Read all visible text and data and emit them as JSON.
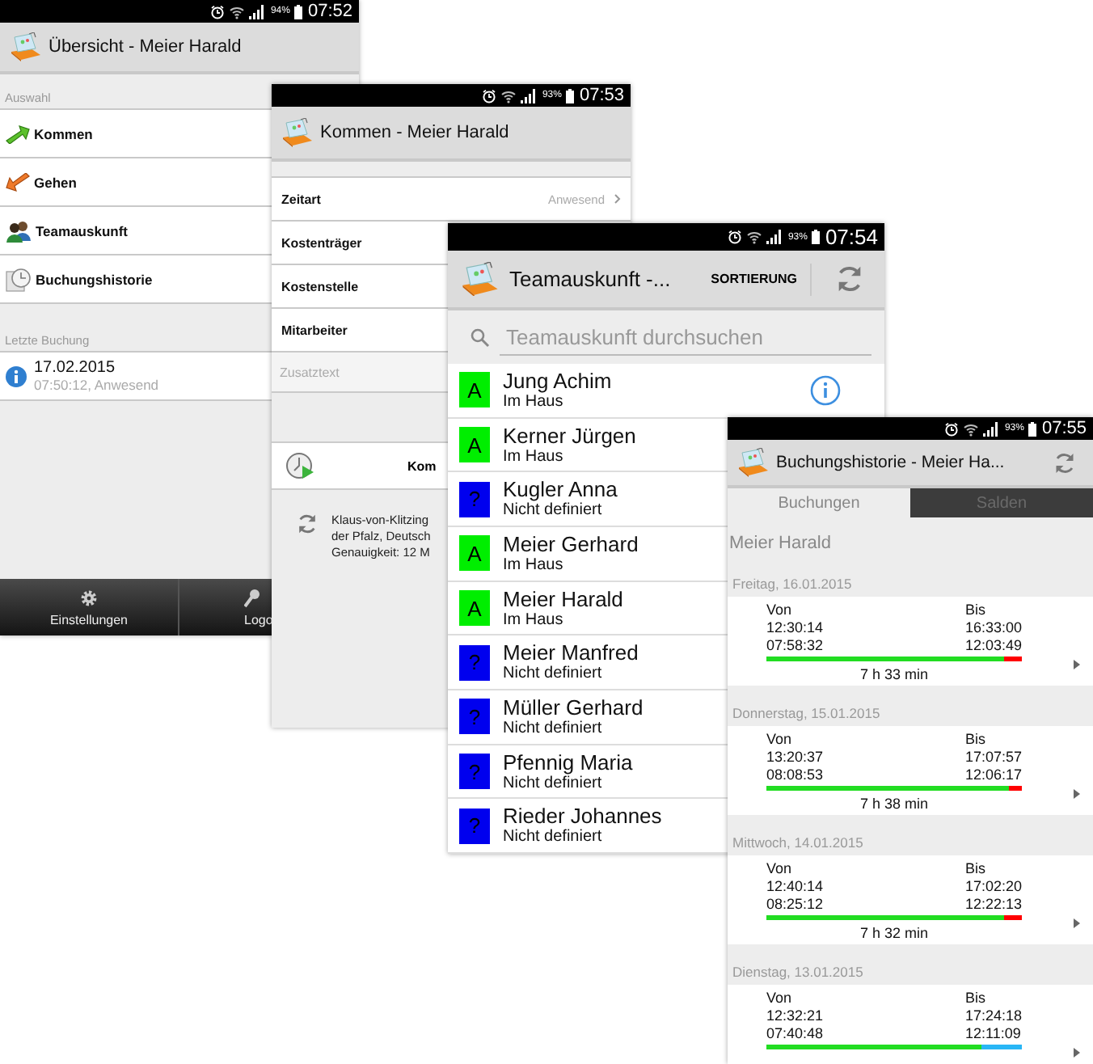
{
  "overview": {
    "status_bar": {
      "battery": "94%",
      "time": "07:52"
    },
    "title": "Übersicht - Meier Harald",
    "section": "Auswahl",
    "menu": [
      {
        "label": "Kommen",
        "kind": "arrive"
      },
      {
        "label": "Gehen",
        "kind": "leave"
      },
      {
        "label": "Teamauskunft",
        "kind": "team"
      },
      {
        "label": "Buchungshistorie",
        "kind": "history"
      }
    ],
    "last_booking": {
      "heading": "Letzte Buchung",
      "date": "17.02.2015",
      "detail": "07:50:12, Anwesend"
    },
    "bottom_bar": [
      {
        "label": "Einstellungen",
        "kind": "settings"
      },
      {
        "label": "Logo",
        "kind": "key"
      }
    ]
  },
  "kommen": {
    "status_bar": {
      "battery": "93%",
      "time": "07:53"
    },
    "title": "Kommen - Meier Harald",
    "fields": [
      {
        "label": "Zeitart",
        "value": "Anwesend"
      },
      {
        "label": "Kostenträger"
      },
      {
        "label": "Kostenstelle"
      },
      {
        "label": "Mitarbeiter"
      }
    ],
    "note": {
      "placeholder": "Zusatztext"
    },
    "button": "Kom",
    "location": [
      "Klaus-von-Klitzing",
      "der Pfalz, Deutsch",
      "Genauigkeit: 12 M"
    ]
  },
  "team": {
    "status_bar": {
      "battery": "93%",
      "time": "07:54"
    },
    "title": "Teamauskunft -...",
    "action": "SORTIERUNG",
    "search": {
      "placeholder": "Teamauskunft durchsuchen"
    },
    "members": [
      {
        "name": "Jung Achim",
        "status": "Im Haus",
        "badge": "A",
        "color": "#00ee00",
        "show_info": true
      },
      {
        "name": "Kerner Jürgen",
        "status": "Im Haus",
        "badge": "A",
        "color": "#00ee00"
      },
      {
        "name": "Kugler Anna",
        "status": "Nicht definiert",
        "badge": "?",
        "color": "#0000ee"
      },
      {
        "name": "Meier Gerhard",
        "status": "Im Haus",
        "badge": "A",
        "color": "#00ee00"
      },
      {
        "name": "Meier Harald",
        "status": "Im Haus",
        "badge": "A",
        "color": "#00ee00"
      },
      {
        "name": "Meier Manfred",
        "status": "Nicht definiert",
        "badge": "?",
        "color": "#0000ee"
      },
      {
        "name": "Müller Gerhard",
        "status": "Nicht definiert",
        "badge": "?",
        "color": "#0000ee"
      },
      {
        "name": "Pfennig Maria",
        "status": "Nicht definiert",
        "badge": "?",
        "color": "#0000ee"
      },
      {
        "name": "Rieder Johannes",
        "status": "Nicht definiert",
        "badge": "?",
        "color": "#0000ee"
      }
    ]
  },
  "history": {
    "status_bar": {
      "battery": "93%",
      "time": "07:55"
    },
    "title": "Buchungshistorie - Meier Ha...",
    "tabs": [
      {
        "label": "Buchungen",
        "selected": true
      },
      {
        "label": "Salden",
        "selected": false
      }
    ],
    "employee": "Meier Harald",
    "days": [
      {
        "date": "Freitag, 16.01.2015",
        "from_label": "Von",
        "to_label": "Bis",
        "times": [
          [
            "12:30:14",
            "16:33:00"
          ],
          [
            "07:58:32",
            "12:03:49"
          ]
        ],
        "level": 0.93,
        "color": "#ff0000",
        "total": "7 h 33 min"
      },
      {
        "date": "Donnerstag, 15.01.2015",
        "from_label": "Von",
        "to_label": "Bis",
        "times": [
          [
            "13:20:37",
            "17:07:57"
          ],
          [
            "08:08:53",
            "12:06:17"
          ]
        ],
        "level": 0.95,
        "color": "#ff0000",
        "total": "7 h 38 min"
      },
      {
        "date": "Mittwoch, 14.01.2015",
        "from_label": "Von",
        "to_label": "Bis",
        "times": [
          [
            "12:40:14",
            "17:02:20"
          ],
          [
            "08:25:12",
            "12:22:13"
          ]
        ],
        "level": 0.93,
        "color": "#ff0000",
        "total": "7 h 32 min"
      },
      {
        "date": "Dienstag, 13.01.2015",
        "from_label": "Von",
        "to_label": "Bis",
        "times": [
          [
            "12:32:21",
            "17:24:18"
          ],
          [
            "07:40:48",
            "12:11:09"
          ]
        ],
        "level": 0.84,
        "color": "#29b6f6"
      }
    ]
  }
}
